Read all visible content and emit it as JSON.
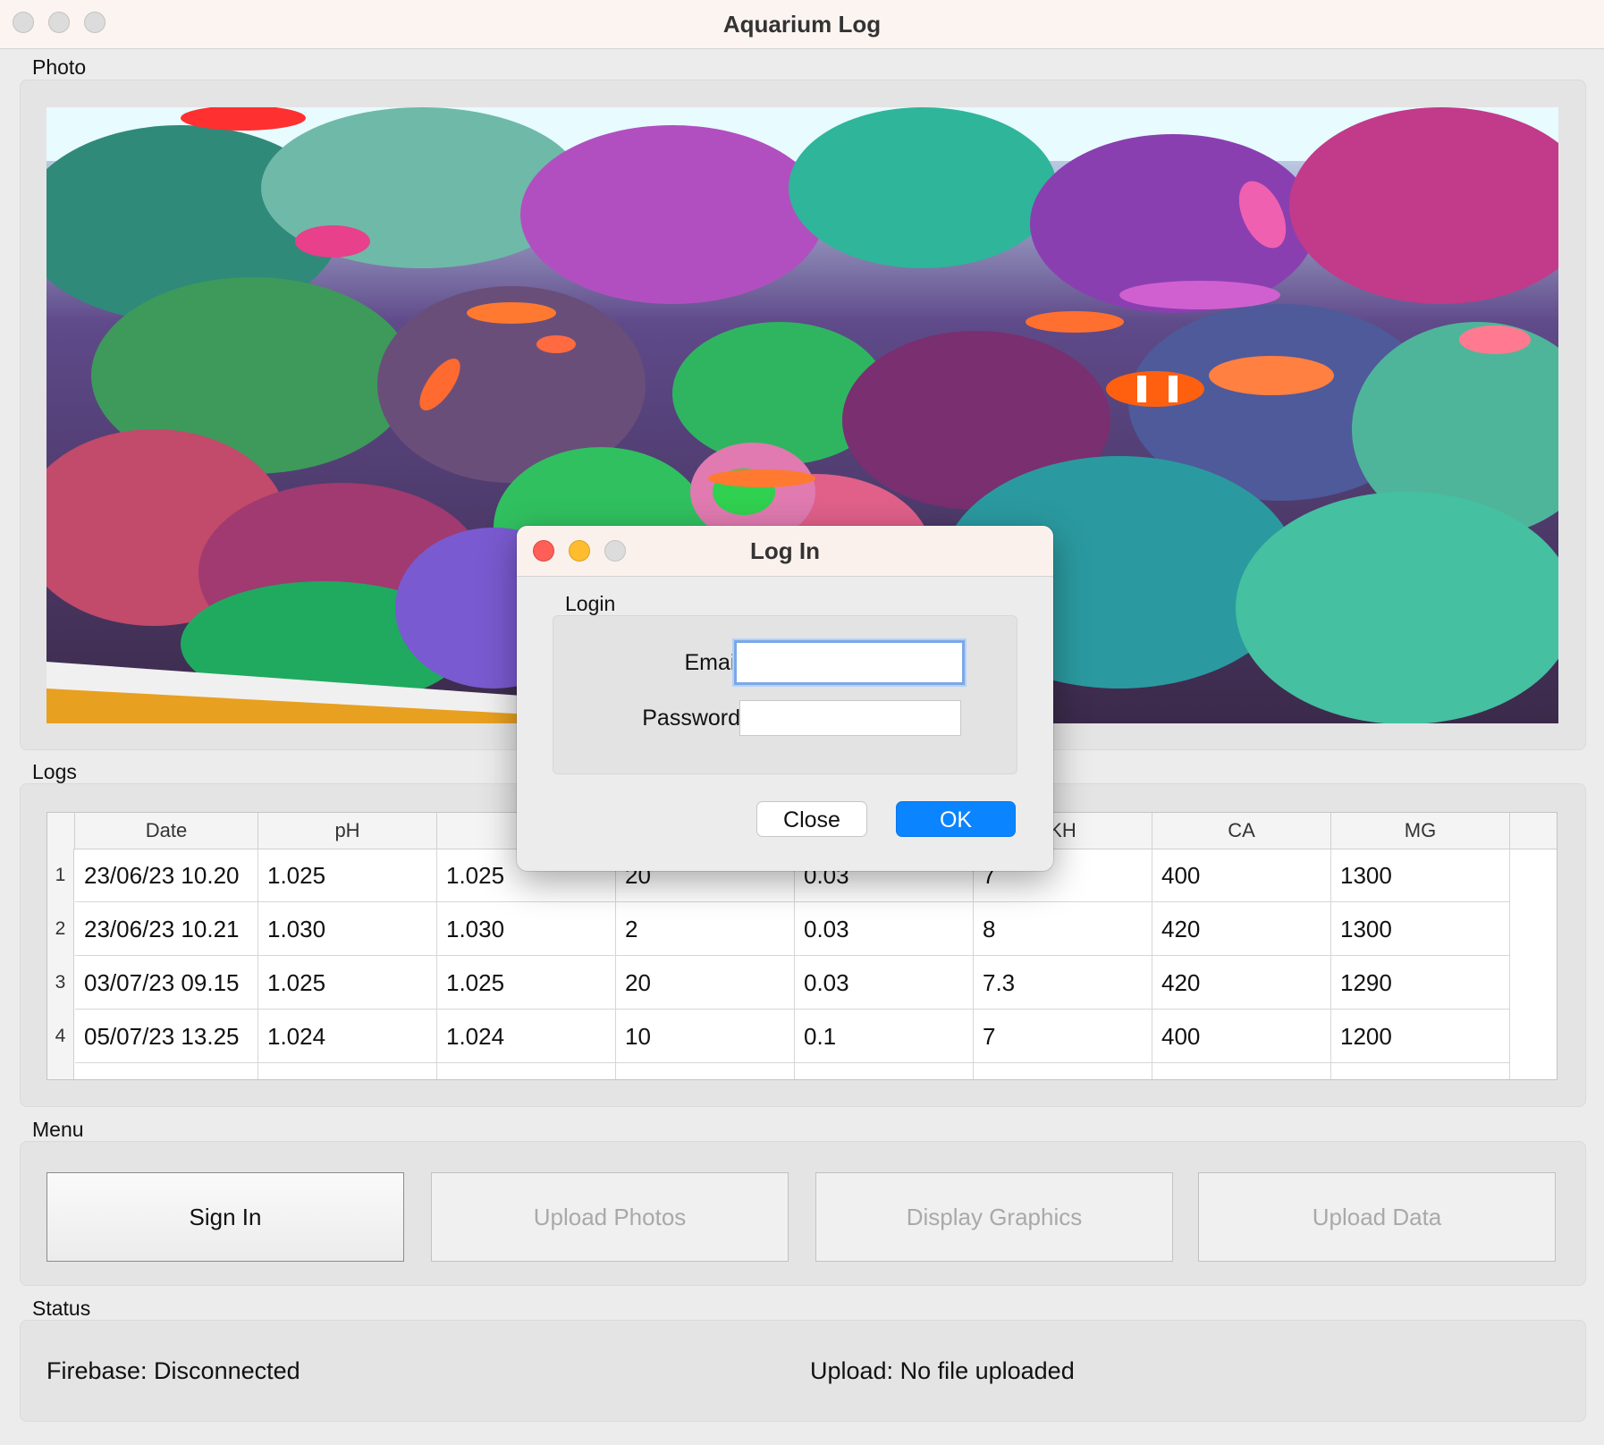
{
  "window": {
    "title": "Aquarium Log"
  },
  "sections": {
    "photo": "Photo",
    "logs": "Logs",
    "menu": "Menu",
    "status": "Status"
  },
  "table": {
    "columns": [
      "Date",
      "pH",
      "",
      "",
      "",
      "KH",
      "CA",
      "MG"
    ],
    "rows": [
      {
        "n": "1",
        "cells": [
          "23/06/23 10.20",
          "1.025",
          "1.025",
          "20",
          "0.03",
          "7",
          "400",
          "1300"
        ]
      },
      {
        "n": "2",
        "cells": [
          "23/06/23 10.21",
          "1.030",
          "1.030",
          "2",
          "0.03",
          "8",
          "420",
          "1300"
        ]
      },
      {
        "n": "3",
        "cells": [
          "03/07/23 09.15",
          "1.025",
          "1.025",
          "20",
          "0.03",
          "7.3",
          "420",
          "1290"
        ]
      },
      {
        "n": "4",
        "cells": [
          "05/07/23 13.25",
          "1.024",
          "1.024",
          "10",
          "0.1",
          "7",
          "400",
          "1200"
        ]
      }
    ]
  },
  "menu": {
    "sign_in": "Sign In",
    "upload_photos": "Upload Photos",
    "display_graphics": "Display Graphics",
    "upload_data": "Upload Data"
  },
  "status": {
    "firebase": "Firebase: Disconnected",
    "upload": "Upload: No file uploaded"
  },
  "dialog": {
    "title": "Log In",
    "group_label": "Login",
    "email_label": "Email",
    "email_value": "",
    "password_label": "Password",
    "password_value": "",
    "close_label": "Close",
    "ok_label": "OK"
  },
  "colors": {
    "accent": "#0a84ff",
    "traffic_red": "#fe5f57",
    "traffic_yellow": "#febc2e"
  },
  "icons": [
    "close-traffic-light-icon",
    "minimize-traffic-light-icon",
    "zoom-traffic-light-icon"
  ]
}
